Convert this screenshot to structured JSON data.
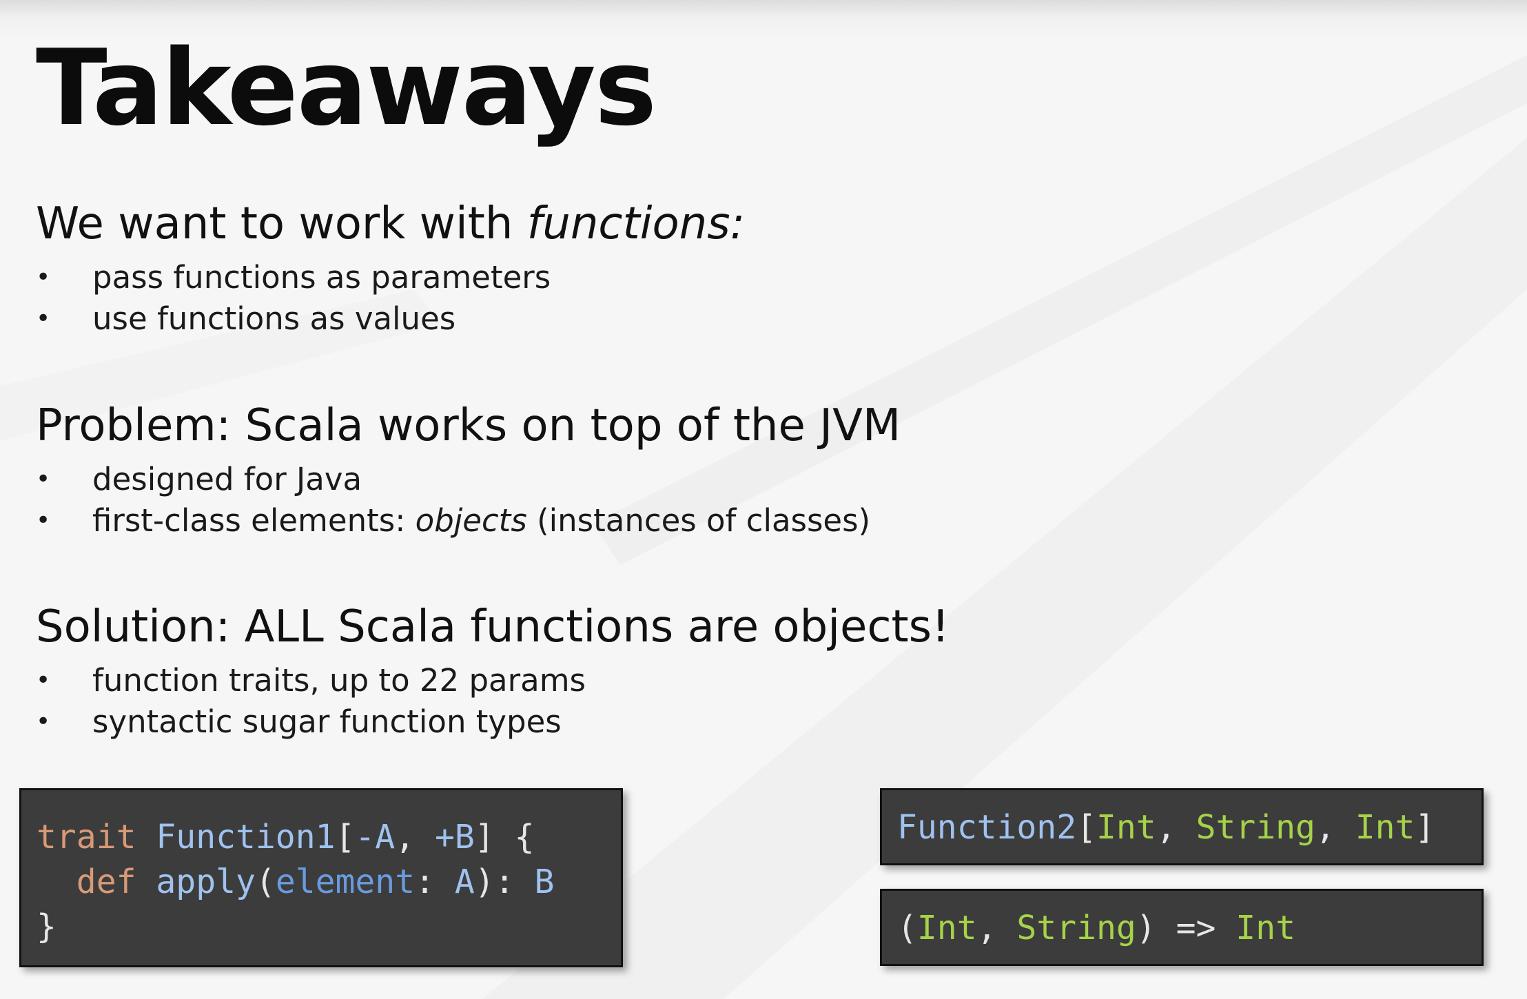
{
  "slide": {
    "title": "Takeaways",
    "sections": [
      {
        "heading_prefix": "We want to work with ",
        "heading_em": "functions:",
        "bullets": [
          "pass functions as parameters",
          "use functions as values"
        ]
      },
      {
        "heading": "Problem: Scala works on top of the JVM",
        "bullets": [
          "designed for Java",
          "first-class elements: ",
          "objects",
          " (instances of classes)"
        ]
      },
      {
        "heading": "Solution: ALL Scala functions are objects!",
        "bullets": [
          "function traits, up to 22 params",
          "syntactic sugar function types"
        ]
      }
    ],
    "bullet_char": "•",
    "code": {
      "trait_box": {
        "line1": [
          "trait",
          " ",
          "Function1",
          "[",
          "-A",
          ", ",
          "+B",
          "] {"
        ],
        "line2": [
          "  ",
          "def",
          " ",
          "apply",
          "(",
          "element",
          ": ",
          "A",
          "): ",
          "B"
        ],
        "line3": [
          "}"
        ]
      },
      "function2_box": [
        "Function2",
        "[",
        "Int",
        ", ",
        "String",
        ", ",
        "Int",
        "]"
      ],
      "sugar_box": [
        "(",
        "Int",
        ", ",
        "String",
        ") => ",
        "Int"
      ]
    },
    "colors": {
      "background": "#f4f4f4",
      "code_background": "#3c3c3c",
      "keyword": "#d89a76",
      "type_name": "#9fc2ef",
      "identifier": "#6a9be0",
      "green_type": "#a6d24a"
    }
  }
}
